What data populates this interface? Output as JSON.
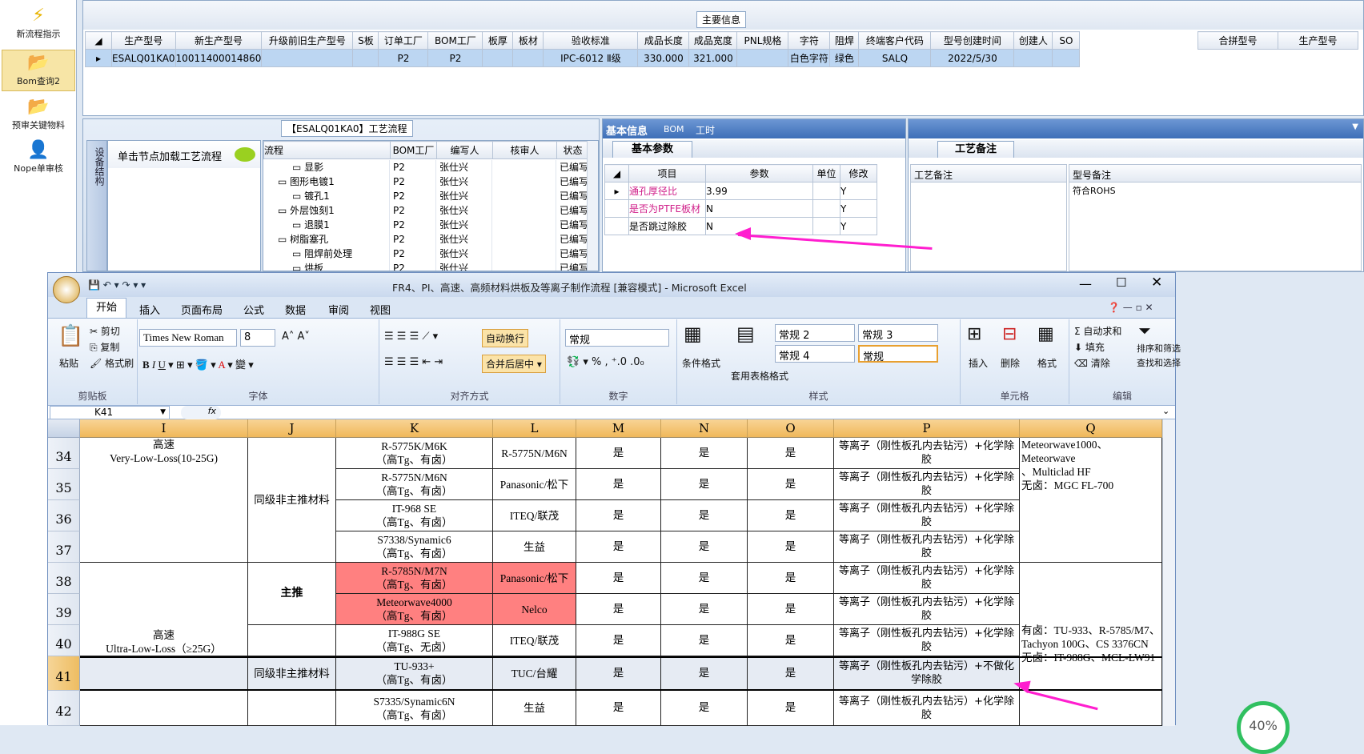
{
  "leftnav": {
    "items": [
      {
        "label": "新流程指示",
        "icon": "lightning-icon"
      },
      {
        "label": "Bom查询2",
        "icon": "folder-icon"
      },
      {
        "label": "预审关键物料",
        "icon": "folder-icon"
      },
      {
        "label": "Nope单审核",
        "icon": "user-icon"
      }
    ]
  },
  "topgrid": {
    "legend": "主要信息",
    "headers": [
      "生产型号",
      "新生产型号",
      "升级前旧生产型号",
      "S板",
      "订单工厂",
      "BOM工厂",
      "板厚",
      "板材",
      "验收标准",
      "成品长度",
      "成品宽度",
      "PNL规格",
      "字符",
      "阻焊",
      "终端客户代码",
      "型号创建时间",
      "创建人",
      "SO"
    ],
    "row": [
      "ESALQ01KA0",
      "10011400014860",
      "",
      "",
      "P2",
      "P2",
      "",
      "",
      "IPC-6012 Ⅱ级",
      "330.000",
      "321.000",
      "",
      "白色字符",
      "绿色",
      "SALQ",
      "2022/5/30",
      "",
      ""
    ],
    "right_headers": [
      "合拼型号",
      "生产型号"
    ]
  },
  "process": {
    "title": "【ESALQ01KA0】工艺流程",
    "side_tab": "设备结构",
    "hint": "单击节点加载工艺流程",
    "headers": [
      "流程",
      "BOM工厂",
      "编写人",
      "核审人",
      "状态"
    ],
    "rows": [
      [
        "显影",
        "P2",
        "张仕兴",
        "",
        "已编写"
      ],
      [
        "图形电镀1",
        "P2",
        "张仕兴",
        "",
        "已编写"
      ],
      [
        "镀孔1",
        "P2",
        "张仕兴",
        "",
        "已编写"
      ],
      [
        "外层蚀刻1",
        "P2",
        "张仕兴",
        "",
        "已编写"
      ],
      [
        "退膜1",
        "P2",
        "张仕兴",
        "",
        "已编写"
      ],
      [
        "树脂塞孔",
        "P2",
        "张仕兴",
        "",
        "已编写"
      ],
      [
        "阻焊前处理",
        "P2",
        "张仕兴",
        "",
        "已编写"
      ],
      [
        "烘板",
        "P2",
        "张仕兴",
        "",
        "已编写"
      ]
    ]
  },
  "info": {
    "tabs": [
      "基本信息",
      "BOM",
      "工时"
    ],
    "subtab": "基本参数",
    "headers": [
      "项目",
      "参数",
      "单位",
      "修改"
    ],
    "rows": [
      [
        "通孔厚径比",
        "3.99",
        "",
        "Y"
      ],
      [
        "是否为PTFE板材",
        "N",
        "",
        "Y"
      ],
      [
        "是否跳过除胶",
        "N",
        "",
        "Y"
      ]
    ]
  },
  "remarks": {
    "tab": "工艺备注",
    "col1": "工艺备注",
    "col2": "型号备注",
    "value": "符合ROHS"
  },
  "excel": {
    "title": "FR4、PI、高速、高频材料烘板及等离子制作流程  [兼容模式] - Microsoft Excel",
    "tabs": [
      "开始",
      "插入",
      "页面布局",
      "公式",
      "数据",
      "审阅",
      "视图"
    ],
    "clipboard": {
      "paste": "粘贴",
      "cut": "剪切",
      "copy": "复制",
      "format_painter": "格式刷",
      "label": "剪贴板"
    },
    "font": {
      "name": "Times New Roman",
      "size": "8",
      "label": "字体"
    },
    "align": {
      "wrap": "自动换行",
      "merge": "合并后居中",
      "label": "对齐方式"
    },
    "number": {
      "format": "常规",
      "label": "数字"
    },
    "styles": {
      "cond": "条件格式",
      "table": "套用表格格式",
      "cells": [
        "常规 2",
        "常规 3",
        "常规 4",
        "常规"
      ],
      "label": "样式"
    },
    "cells_grp": {
      "insert": "插入",
      "delete": "删除",
      "format": "格式",
      "label": "单元格"
    },
    "edit": {
      "autosum": "自动求和",
      "fill": "填充",
      "clear": "清除",
      "sort": "排序和筛选",
      "find": "查找和选择",
      "label": "编辑"
    },
    "namebox": "K41",
    "fx": "fx",
    "columns": [
      "I",
      "J",
      "K",
      "L",
      "M",
      "N",
      "O",
      "P",
      "Q"
    ],
    "rownums": [
      "34",
      "35",
      "36",
      "37",
      "38",
      "39",
      "40",
      "41",
      "42"
    ],
    "cells": {
      "I_a": "高速\nVery-Low-Loss(10-25G)",
      "I_b": "高速\nUltra-Low-Loss（≥25G）",
      "J_a": "同级非主推材料",
      "J_b": "主推",
      "J_c": "同级非主推材料",
      "K": [
        "R-5775K/M6K\n（高Tg、有卤）",
        "R-5775N/M6N\n（高Tg、有卤）",
        "IT-968 SE\n（高Tg、有卤）",
        "S7338/Synamic6\n（高Tg、有卤）",
        "R-5785N/M7N\n（高Tg、有卤）",
        "Meteorwave4000\n（高Tg、有卤）",
        "IT-988G SE\n（高Tg、无卤）",
        "TU-933+\n（高Tg、有卤）",
        "S7335/Synamic6N\n（高Tg、有卤）"
      ],
      "L": [
        "R-5775N/M6N",
        "Panasonic/松下",
        "ITEQ/联茂",
        "生益",
        "Panasonic/松下",
        "Nelco",
        "ITEQ/联茂",
        "TUC/台耀",
        "生益"
      ],
      "yes": "是",
      "P": "等离子（刚性板孔内去钻污）+化学除胶",
      "P41": "等离子（刚性板孔内去钻污）+不做化学除胶",
      "Q_a": "Meteorwave1000、Meteorwave\n、Multiclad HF",
      "Q_a2": "无卤：MGC FL-700",
      "Q_b1": "有卤：TU-933、R-5785/M7、\nTachyon 100G、CS 3376CN",
      "Q_b2": "无卤：IT-988G、MCL-LW91"
    }
  },
  "progress": "40%"
}
